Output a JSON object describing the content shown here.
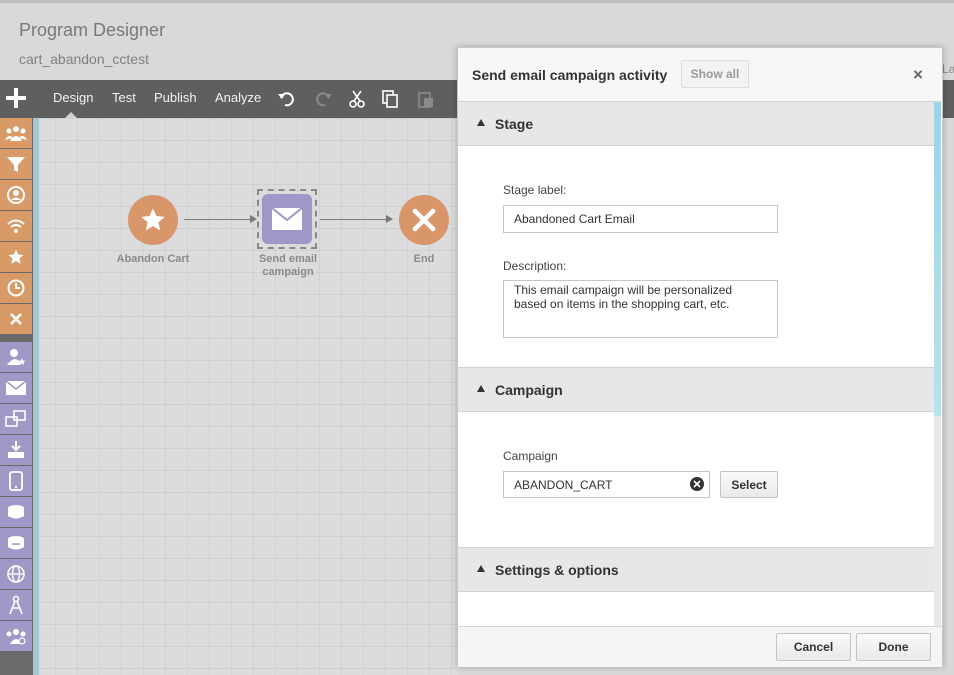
{
  "header": {
    "title": "Program Designer",
    "subtitle": "cart_abandon_cctest"
  },
  "toolbar": {
    "tabs": [
      "Design",
      "Test",
      "Publish",
      "Analyze"
    ]
  },
  "canvas": {
    "nodes": [
      {
        "label": "Abandon Cart"
      },
      {
        "label": "Send email campaign"
      },
      {
        "label": "End"
      }
    ]
  },
  "side_text": "La",
  "dialog": {
    "title": "Send email campaign activity",
    "show_all": "Show all",
    "close": "×",
    "sections": {
      "stage": {
        "title": "Stage",
        "stage_label_label": "Stage label:",
        "stage_label_value": "Abandoned Cart Email",
        "description_label": "Description:",
        "description_value": "This email campaign will be personalized based on items in the shopping cart, etc."
      },
      "campaign": {
        "title": "Campaign",
        "campaign_label": "Campaign",
        "campaign_value": "ABANDON_CART",
        "select_label": "Select"
      },
      "settings": {
        "title": "Settings & options"
      }
    },
    "footer": {
      "cancel": "Cancel",
      "done": "Done"
    }
  },
  "colors": {
    "orange_node": "#d9966a",
    "purple_node": "#9e97c7",
    "toolbar": "#5f5f5f"
  }
}
